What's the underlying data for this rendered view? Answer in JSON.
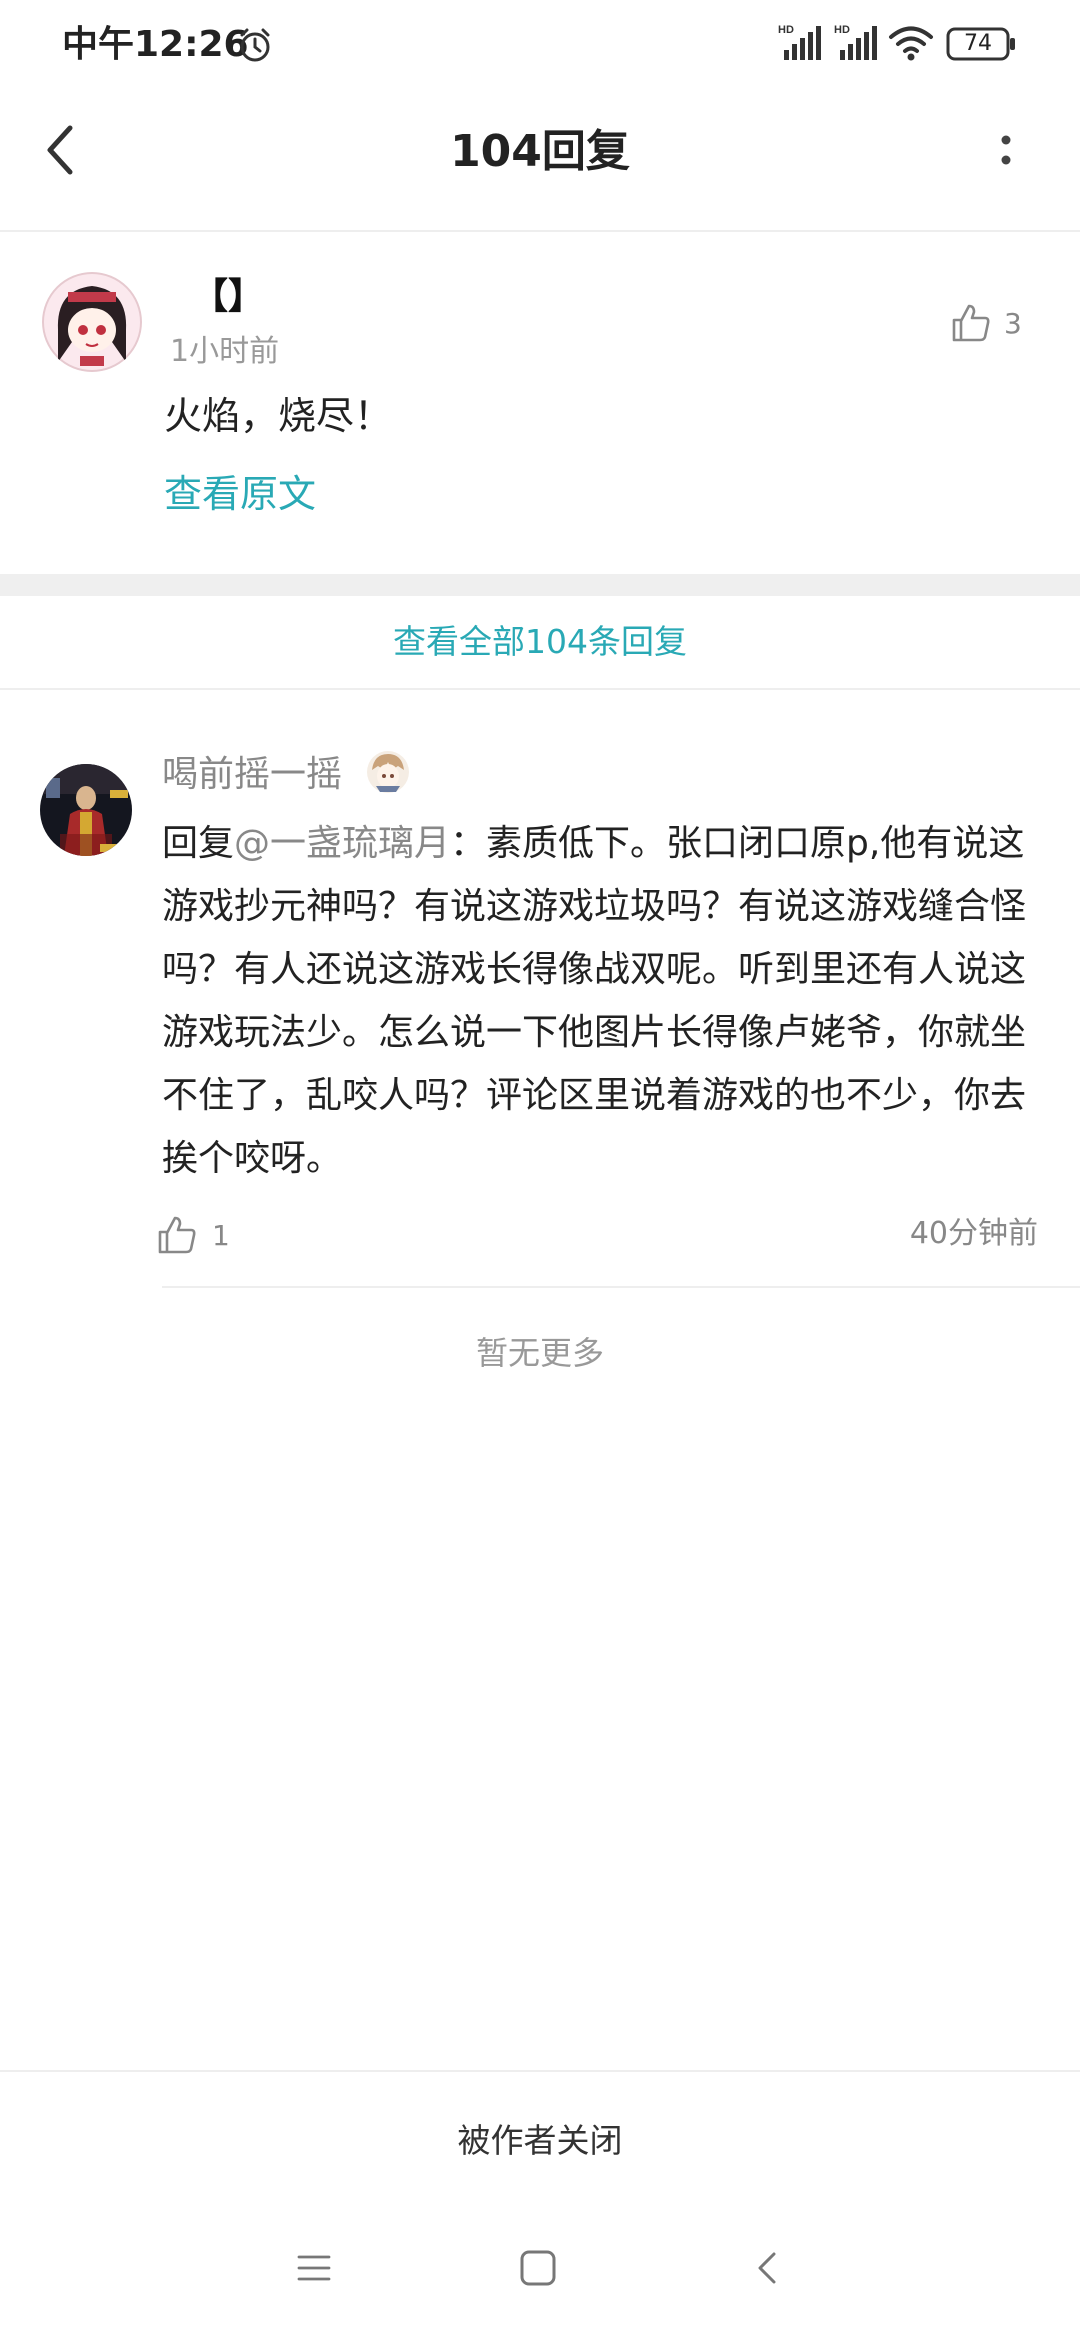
{
  "status_bar": {
    "time": "中午12:26",
    "signal_1_label": "HD",
    "signal_2_label": "HD",
    "battery": "74"
  },
  "header": {
    "title": "104回复",
    "back_icon": "chevron-left-icon",
    "more_icon": "more-vertical-icon"
  },
  "original_post": {
    "author": "【】",
    "time": "1小时前",
    "likes": "3",
    "text": "火焰，烧尽！",
    "view_original_label": "查看原文"
  },
  "view_all_label": "查看全部104条回复",
  "reply": {
    "author": "喝前摇一摇",
    "reply_prefix": "回复",
    "mention": "@一盏琉璃月",
    "text": "：素质低下。张口闭口原p,他有说这游戏抄元神吗？有说这游戏垃圾吗？有说这游戏缝合怪吗？有人还说这游戏长得像战双呢。听到里还有人说这游戏玩法少。怎么说一下他图片长得像卢姥爷，你就坐不住了，乱咬人吗？评论区里说着游戏的也不少，你去挨个咬呀。",
    "likes": "1",
    "time": "40分钟前"
  },
  "no_more_label": "暂无更多",
  "closed_label": "被作者关闭",
  "colors": {
    "accent": "#29a9b5",
    "muted": "#888888",
    "divider": "#eeeeee"
  }
}
